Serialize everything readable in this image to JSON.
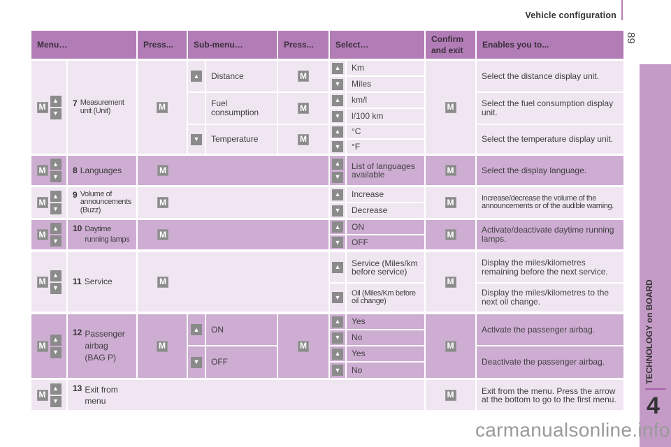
{
  "page": {
    "section_title": "Vehicle configuration",
    "page_number": "89",
    "side_tab_label": "TECHNOLOGY on BOARD",
    "chapter_number": "4",
    "watermark": "carmanualsonline.info"
  },
  "icons": {
    "m_button": "M",
    "up_arrow": "▲",
    "down_arrow": "▼"
  },
  "colors": {
    "header": "#b27cb6",
    "row_light": "#efe6f1",
    "row_dark": "#ceadd3",
    "button_grey": "#8b8b8b",
    "side_tab": "#c49bc7"
  },
  "table": {
    "headers": [
      "Menu…",
      "Press...",
      "Sub-menu…",
      "Press...",
      "Select…",
      "Confirm and exit",
      "Enables you to..."
    ],
    "rows": [
      {
        "number": "7",
        "menu": "Measurement unit (Unit)",
        "submenus": [
          {
            "arrow": "up",
            "label": "Distance",
            "options": [
              {
                "arrow": "up",
                "label": "Km"
              },
              {
                "arrow": "down",
                "label": "Miles"
              }
            ],
            "description": "Select the distance display unit."
          },
          {
            "arrow": "",
            "label": "Fuel consumption",
            "options": [
              {
                "arrow": "up",
                "label": "km/l"
              },
              {
                "arrow": "down",
                "label": "l/100 km"
              }
            ],
            "description": "Select the fuel consumption display unit."
          },
          {
            "arrow": "down",
            "label": "Temperature",
            "options": [
              {
                "arrow": "up",
                "label": "°C"
              },
              {
                "arrow": "down",
                "label": "°F"
              }
            ],
            "description": "Select the temperature display unit."
          }
        ]
      },
      {
        "number": "8",
        "menu": "Languages",
        "options": [
          {
            "arrow": "up",
            "label": "List of languages available"
          }
        ],
        "description": "Select the display language."
      },
      {
        "number": "9",
        "menu": "Volume of announcements (Buzz)",
        "options": [
          {
            "arrow": "up",
            "label": "Increase"
          },
          {
            "arrow": "down",
            "label": "Decrease"
          }
        ],
        "description": "Increase/decrease the volume of the announcements or of the audible warning."
      },
      {
        "number": "10",
        "menu": "Daytime running lamps",
        "options": [
          {
            "arrow": "up",
            "label": "ON"
          },
          {
            "arrow": "down",
            "label": "OFF"
          }
        ],
        "description": "Activate/deactivate daytime running lamps."
      },
      {
        "number": "11",
        "menu": "Service",
        "options": [
          {
            "arrow": "up",
            "label": "Service (Miles/km before service)",
            "description": "Display the miles/kilometres remaining before the next service."
          },
          {
            "arrow": "down",
            "label": "Oil (Miles/Km before oil change)",
            "description": "Display the miles/kilometres to the next oil change."
          }
        ]
      },
      {
        "number": "12",
        "menu": "Passenger airbag (BAG P)",
        "submenus": [
          {
            "arrow": "up",
            "label": "ON",
            "options": [
              {
                "arrow": "up",
                "label": "Yes"
              },
              {
                "arrow": "down",
                "label": "No"
              }
            ],
            "description": "Activate the passenger airbag."
          },
          {
            "arrow": "down",
            "label": "OFF",
            "options": [
              {
                "arrow": "up",
                "label": "Yes"
              },
              {
                "arrow": "down",
                "label": "No"
              }
            ],
            "description": "Deactivate the passenger airbag."
          }
        ]
      },
      {
        "number": "13",
        "menu": "Exit from menu",
        "description": "Exit from the menu. Press the arrow at the bottom to go to the first menu."
      }
    ]
  }
}
